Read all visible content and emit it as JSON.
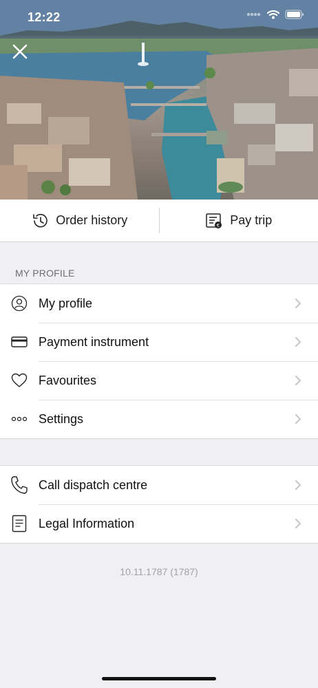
{
  "status_bar": {
    "time": "12:22"
  },
  "hero": {
    "image_icon": "city-aerial-photo"
  },
  "actions": {
    "order_history": {
      "label": "Order history",
      "icon": "history-clock-icon"
    },
    "pay_trip": {
      "label": "Pay trip",
      "icon": "receipt-icon"
    }
  },
  "profile_section": {
    "header": "MY PROFILE",
    "items": [
      {
        "label": "My profile",
        "icon": "user-icon"
      },
      {
        "label": "Payment instrument",
        "icon": "credit-card-icon"
      },
      {
        "label": "Favourites",
        "icon": "heart-icon"
      },
      {
        "label": "Settings",
        "icon": "more-dots-icon"
      }
    ]
  },
  "support_section": {
    "items": [
      {
        "label": "Call dispatch centre",
        "icon": "phone-icon"
      },
      {
        "label": "Legal Information",
        "icon": "document-icon"
      }
    ]
  },
  "version": "10.11.1787 (1787)"
}
